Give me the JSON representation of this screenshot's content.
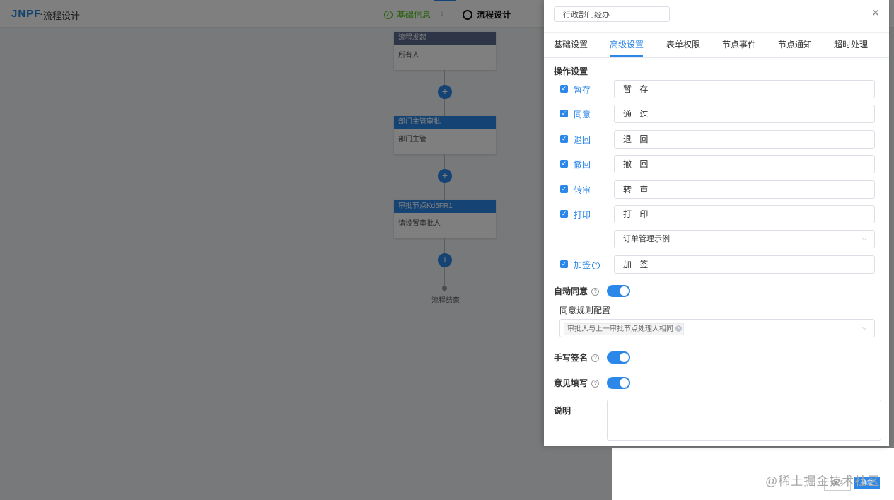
{
  "app": {
    "logo": "JNPF",
    "title_sep": "·",
    "title": "流程设计",
    "steps": [
      {
        "label": "基础信息",
        "state": "done"
      },
      {
        "label": "流程设计",
        "state": "current"
      }
    ],
    "step_done_icon": "check-circle-icon"
  },
  "flow": {
    "nodes": [
      {
        "title": "流程发起",
        "body": "所有人"
      },
      {
        "title": "部门主管审批",
        "body": "部门主管"
      },
      {
        "title": "审批节点Kd5FR1",
        "body": "请设置审批人"
      }
    ],
    "add_symbol": "+",
    "end_label": "流程结束"
  },
  "footer": {
    "cancel": "取消",
    "ok": "确定",
    "watermark": "@稀土掘金技术社区"
  },
  "drawer": {
    "node_name": "行政部门经办",
    "close_symbol": "×",
    "tabs": [
      "基础设置",
      "高级设置",
      "表单权限",
      "节点事件",
      "节点通知",
      "超时处理"
    ],
    "active_tab": "高级设置",
    "section_title": "操作设置",
    "operations": [
      {
        "label": "暂存",
        "checked": true,
        "value": "暂 存"
      },
      {
        "label": "同意",
        "checked": true,
        "value": "通 过"
      },
      {
        "label": "退回",
        "checked": true,
        "value": "退 回"
      },
      {
        "label": "撤回",
        "checked": true,
        "value": "撤 回"
      },
      {
        "label": "转审",
        "checked": true,
        "value": "转 审"
      },
      {
        "label": "打印",
        "checked": true,
        "value": "打 印"
      }
    ],
    "print_template": "订单管理示例",
    "countersign": {
      "label": "加签",
      "checked": true,
      "value": "加 签"
    },
    "auto_approve": {
      "label": "自动同意",
      "on": true
    },
    "approve_rule_label": "同意规则配置",
    "approve_rule_tag": "审批人与上一审批节点处理人相同",
    "handwritten_sign": {
      "label": "手写签名",
      "on": true
    },
    "opinion_fill": {
      "label": "意见填写",
      "on": true
    },
    "description_label": "说明",
    "accent_color": "#2b87e8"
  }
}
